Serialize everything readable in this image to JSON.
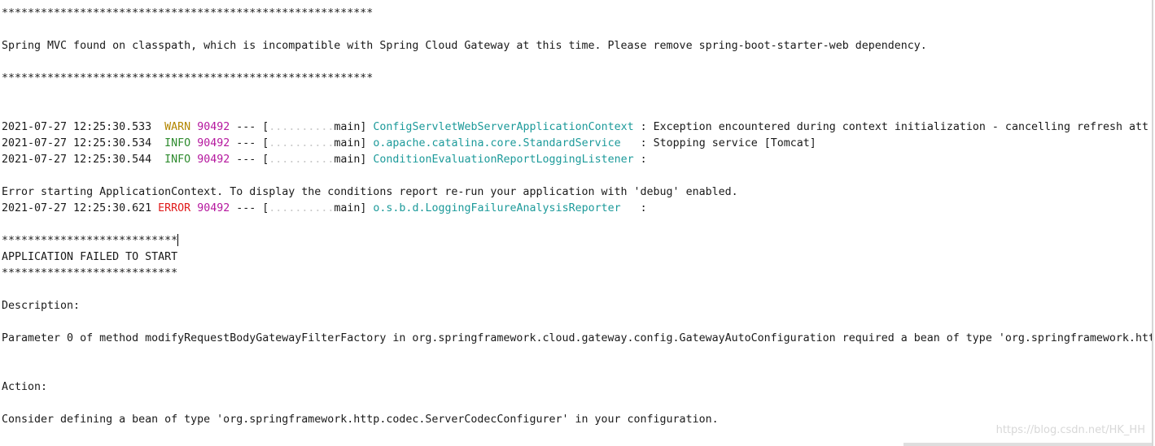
{
  "banner": {
    "stars": "*********************************************************",
    "message": "Spring MVC found on classpath, which is incompatible with Spring Cloud Gateway at this time. Please remove spring-boot-starter-web dependency."
  },
  "log": {
    "separator": "---",
    "open_bracket": "[",
    "thread": "main]",
    "thread_pad": "..........",
    "entries": [
      {
        "timestamp": "2021-07-27 12:25:30.533",
        "level": " WARN",
        "pid": "90492",
        "logger": "ConfigServletWebServerApplicationContext",
        "message": " : Exception encountered during context initialization - cancelling refresh att"
      },
      {
        "timestamp": "2021-07-27 12:25:30.534",
        "level": " INFO",
        "pid": "90492",
        "logger": "o.apache.catalina.core.StandardService",
        "message": "   : Stopping service [Tomcat]"
      },
      {
        "timestamp": "2021-07-27 12:25:30.544",
        "level": " INFO",
        "pid": "90492",
        "logger": "ConditionEvaluationReportLoggingListener",
        "message": " :"
      },
      {
        "timestamp": "2021-07-27 12:25:30.621",
        "level": "ERROR",
        "pid": "90492",
        "logger": "o.s.b.d.LoggingFailureAnalysisReporter",
        "message": "   :"
      }
    ],
    "context_error": "Error starting ApplicationContext. To display the conditions report re-run your application with 'debug' enabled."
  },
  "failure": {
    "stars": "***************************",
    "title": "APPLICATION FAILED TO START",
    "description_label": "Description:",
    "description_text": "Parameter 0 of method modifyRequestBodyGatewayFilterFactory in org.springframework.cloud.gateway.config.GatewayAutoConfiguration required a bean of type 'org.springframework.htt",
    "action_label": "Action:",
    "action_text": "Consider defining a bean of type 'org.springframework.http.codec.ServerCodecConfigurer' in your configuration."
  },
  "watermark": "https://blog.csdn.net/HK_HH",
  "colors": {
    "warn": "#b38600",
    "info": "#2e8b2e",
    "error": "#e01b1b",
    "pid": "#b5179e",
    "logger": "#1c9a9a"
  }
}
